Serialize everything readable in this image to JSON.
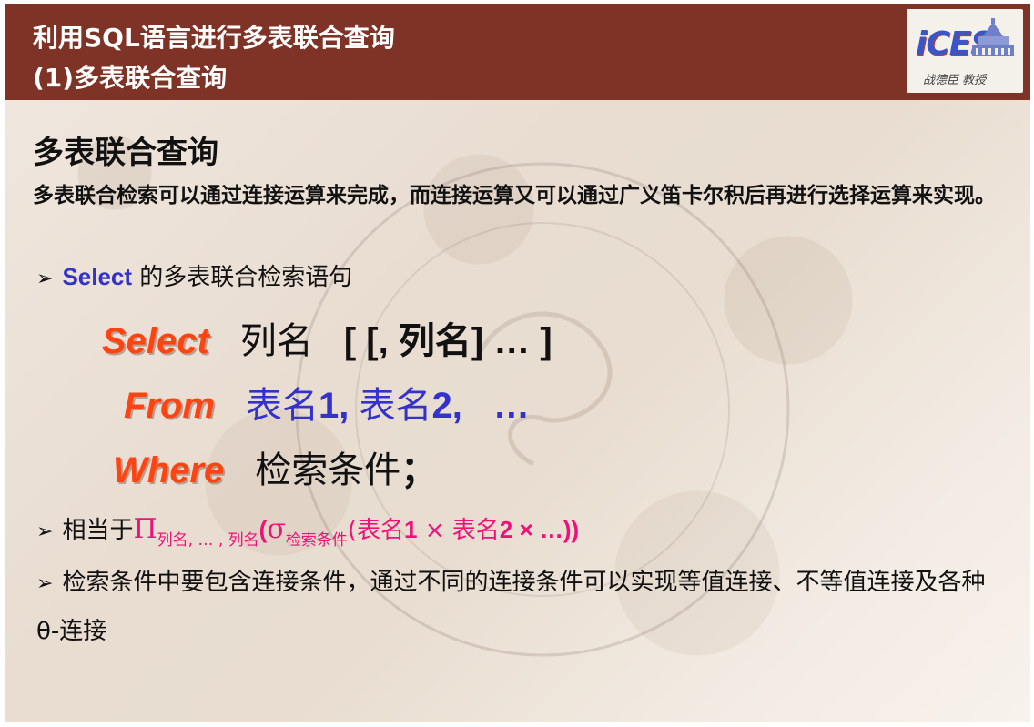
{
  "header": {
    "title_line1": "利用SQL语言进行多表联合查询",
    "title_line2": "(1)多表联合查询",
    "logo": {
      "mark": "iCES",
      "signature": "战德臣 教授"
    },
    "colors": {
      "background": "#7f3326",
      "text": "#ffffff"
    }
  },
  "slide": {
    "heading": "多表联合查询",
    "description": "多表联合检索可以通过连接运算来完成，而连接运算又可以通过广义笛卡尔积后再进行选择运算来实现。",
    "bullet1": {
      "keyword": "Select",
      "text": " 的多表联合检索语句"
    },
    "sql": {
      "select_kw": "Select",
      "select_rest": "列名",
      "select_bracket": "[ [, 列名] … ]",
      "from_kw": "From",
      "from_t1": "表名",
      "from_n1": "1, ",
      "from_t2": "表名",
      "from_n2": "2,",
      "from_dots": "…",
      "where_kw": "Where",
      "where_rest": "检索条件",
      "where_semi": "；"
    },
    "bullet2": {
      "prefix": "相当于",
      "pi": "Π",
      "pi_sub": "列名, … , 列名",
      "open_sigma": "(",
      "sigma": "σ",
      "sigma_sub": "检索条件",
      "expr_open": "(",
      "t1": "表名",
      "n1": "1",
      "times1": " × ",
      "t2": "表名",
      "n2": "2",
      "times2": " × …))"
    },
    "bullet3": "检索条件中要包含连接条件，通过不同的连接条件可以实现等值连接、不等值连接及各种θ-连接"
  },
  "colors": {
    "sql_keyword": "#ff4411",
    "blue": "#3333cc",
    "magenta": "#ee1177"
  }
}
